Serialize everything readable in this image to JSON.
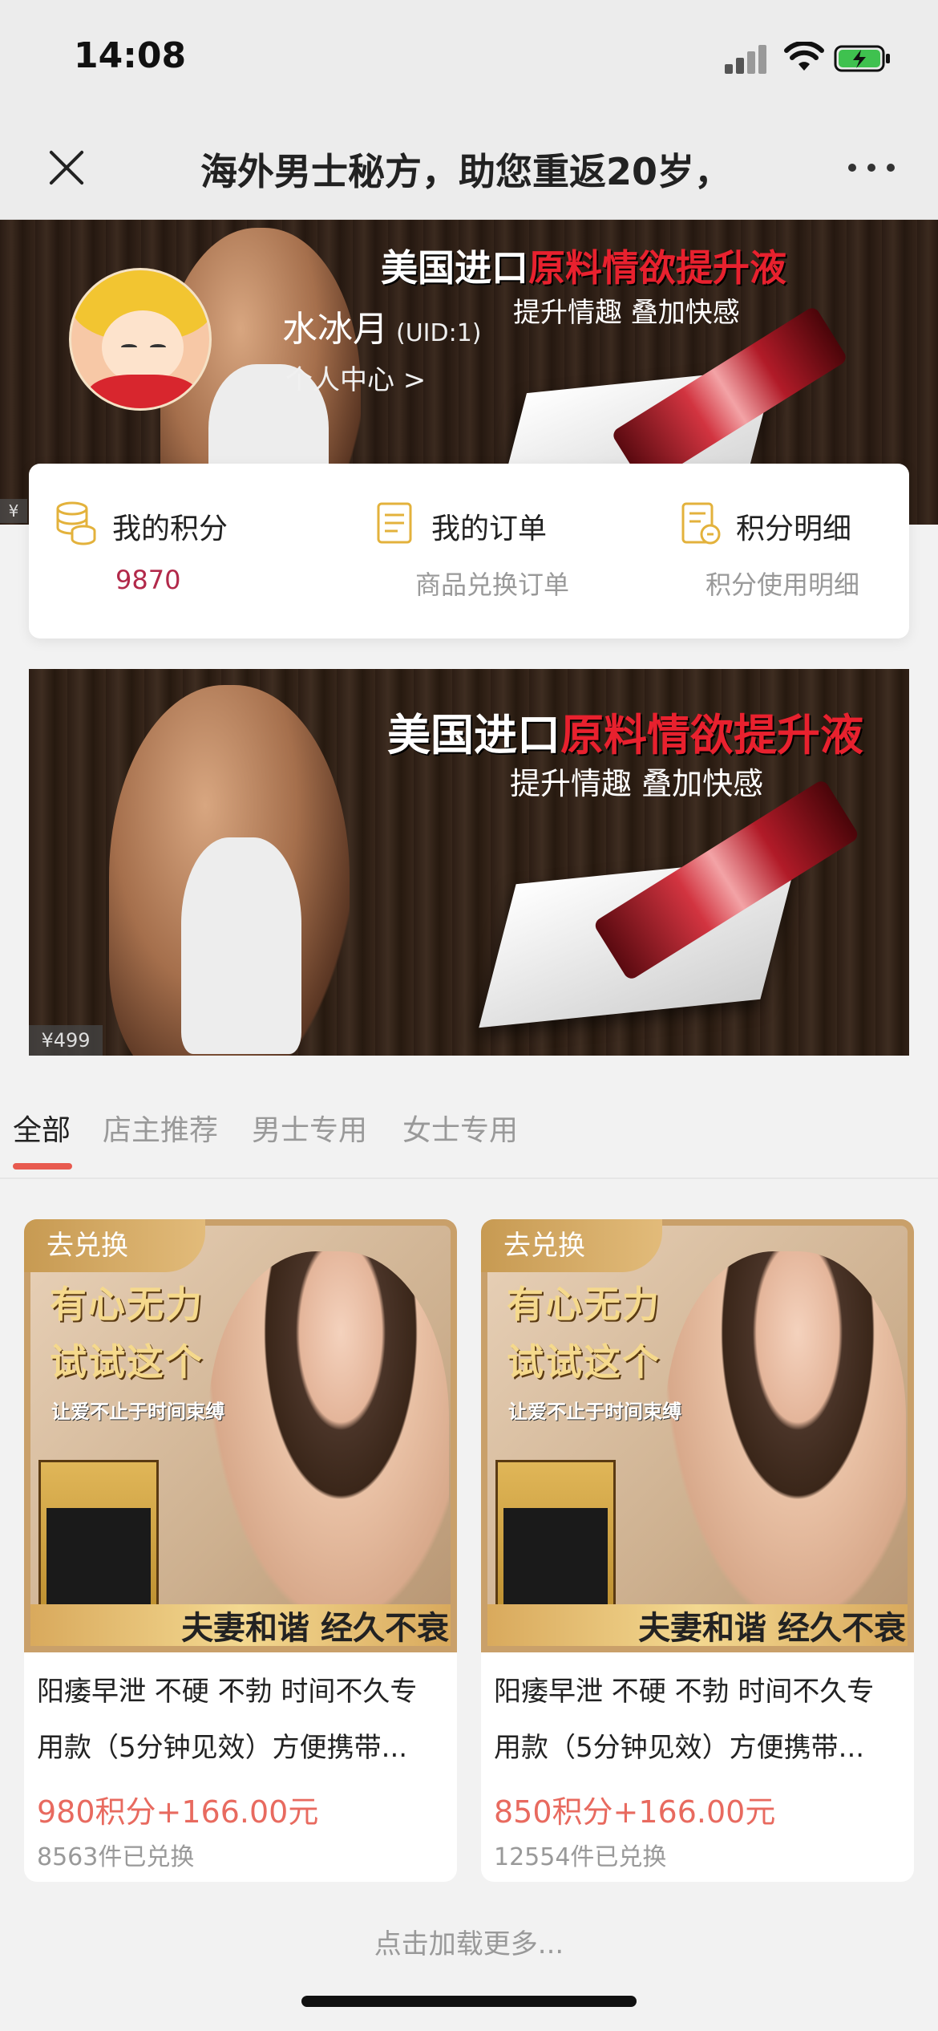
{
  "status_bar": {
    "time": "14:08"
  },
  "nav": {
    "title": "海外男士秘方，助您重返20岁，"
  },
  "header_ad": {
    "line1_white": "美国进口",
    "line1_red": "原料情欲提升液",
    "line2": "提升情趣 叠加快感",
    "price_tag": "¥"
  },
  "user": {
    "name": "水冰月",
    "uid": "(UID:1)",
    "center_link": "个人中心 >"
  },
  "stats": [
    {
      "label": "我的积分",
      "sub": "9870",
      "icon": "coins-icon"
    },
    {
      "label": "我的订单",
      "sub": "商品兑换订单",
      "icon": "order-icon"
    },
    {
      "label": "积分明细",
      "sub": "积分使用明细",
      "icon": "points-detail-icon"
    }
  ],
  "banner": {
    "line1_white": "美国进口",
    "line1_red": "原料情欲提升液",
    "line2": "提升情趣 叠加快感",
    "price_tag": "¥499"
  },
  "tabs": [
    {
      "label": "全部",
      "active": true
    },
    {
      "label": "店主推荐",
      "active": false
    },
    {
      "label": "男士专用",
      "active": false
    },
    {
      "label": "女士专用",
      "active": false
    }
  ],
  "products": [
    {
      "badge": "去兑换",
      "img_head1": "有心无力",
      "img_head2": "试试这个",
      "img_sub": "让爱不止于时间束缚",
      "img_foot": "夫妻和谐 经久不衰",
      "title_line1": "阳痿早泄 不硬 不勃 时间不久专",
      "title_line2": "用款（5分钟见效）方便携带...",
      "price": "980积分+166.00元",
      "sold": "8563件已兑换"
    },
    {
      "badge": "去兑换",
      "img_head1": "有心无力",
      "img_head2": "试试这个",
      "img_sub": "让爱不止于时间束缚",
      "img_foot": "夫妻和谐 经久不衰",
      "title_line1": "阳痿早泄 不硬 不勃 时间不久专",
      "title_line2": "用款（5分钟见效）方便携带...",
      "price": "850积分+166.00元",
      "sold": "12554件已兑换"
    }
  ],
  "load_more": "点击加载更多...",
  "colors": {
    "accent_red": "#e86a5f",
    "points_value": "#b2294a",
    "icon_gold": "#e3b23c"
  }
}
